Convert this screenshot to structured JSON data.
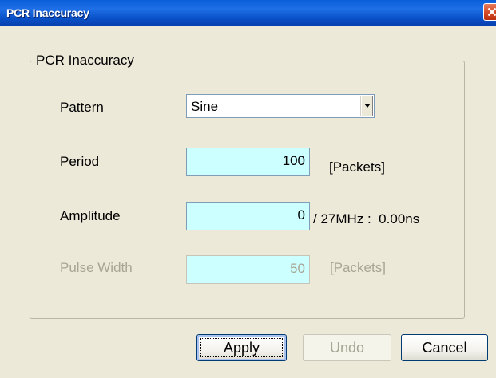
{
  "window": {
    "title": "PCR Inaccuracy"
  },
  "group": {
    "legend": "PCR Inaccuracy"
  },
  "pattern": {
    "label": "Pattern",
    "selected": "Sine"
  },
  "period": {
    "label": "Period",
    "value": "100",
    "unit": "[Packets]"
  },
  "amplitude": {
    "label": "Amplitude",
    "value": "0",
    "suffix": "/ 27MHz :  0.00ns"
  },
  "pulse_width": {
    "label": "Pulse Width",
    "value": "50",
    "unit": "[Packets]",
    "enabled": false
  },
  "buttons": {
    "apply": "Apply",
    "undo": "Undo",
    "cancel": "Cancel"
  },
  "icons": {
    "close": "close-icon",
    "dropdown": "chevron-down-icon"
  },
  "colors": {
    "titlebar": "#0a52c9",
    "field_bg": "#ccffff",
    "disabled_text": "#a7a593"
  }
}
